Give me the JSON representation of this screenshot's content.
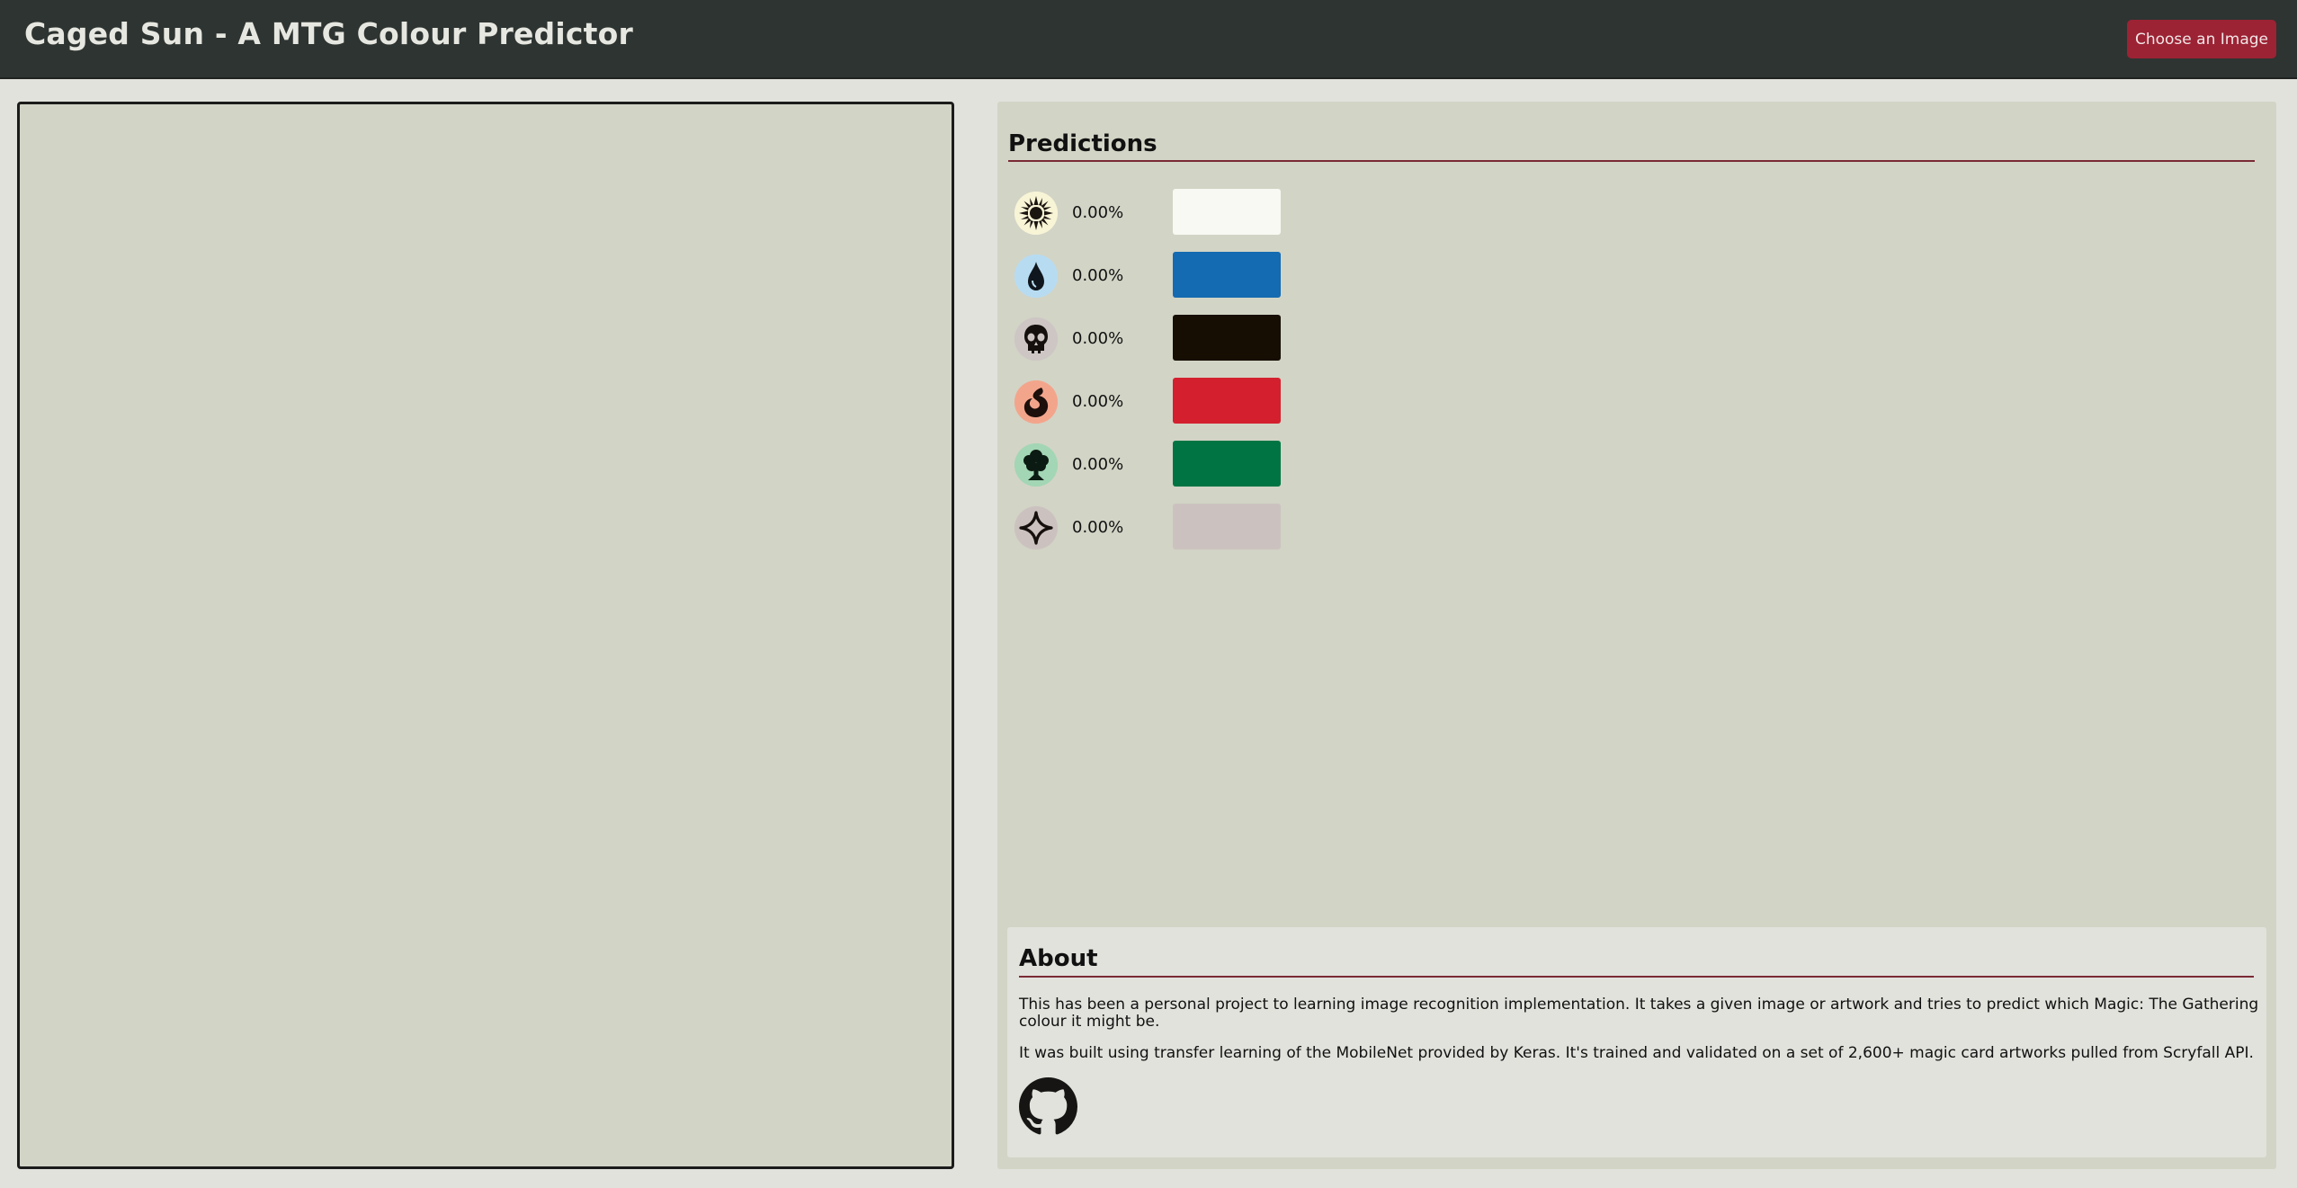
{
  "header": {
    "title": "Caged Sun - A MTG Colour Predictor",
    "choose_button_label": "Choose an Image"
  },
  "predictions": {
    "title": "Predictions",
    "rows": [
      {
        "icon": "white-sun-mana-icon",
        "percent": "0.00%",
        "swatch_color": "#f8f9f2",
        "icon_bg": "#f8f4d6"
      },
      {
        "icon": "blue-drop-mana-icon",
        "percent": "0.00%",
        "swatch_color": "#146bb1",
        "icon_bg": "#b7dcf2"
      },
      {
        "icon": "black-skull-mana-icon",
        "percent": "0.00%",
        "swatch_color": "#160e03",
        "icon_bg": "#cdc6c4"
      },
      {
        "icon": "red-fire-mana-icon",
        "percent": "0.00%",
        "swatch_color": "#d4202e",
        "icon_bg": "#f3a58c"
      },
      {
        "icon": "green-tree-mana-icon",
        "percent": "0.00%",
        "swatch_color": "#007543",
        "icon_bg": "#a3d6b4"
      },
      {
        "icon": "colorless-diamond-mana-icon",
        "percent": "0.00%",
        "swatch_color": "#cbc2bf",
        "icon_bg": "#cbc2bf"
      }
    ]
  },
  "about": {
    "title": "About",
    "paragraph1": "This has been a personal project to learning image recognition implementation. It takes a given image or artwork and tries to predict which Magic: The Gathering colour it might be.",
    "paragraph2": "It was built using transfer learning of the MobileNet provided by Keras. It's trained and validated on a set of 2,600+ magic card artworks pulled from Scryfall API.",
    "github_icon": "github-icon"
  },
  "colors": {
    "header_bg": "#2e3432",
    "accent": "#9c2334",
    "panel_bg": "#d2d4c6",
    "page_bg": "#e1e2dc"
  }
}
